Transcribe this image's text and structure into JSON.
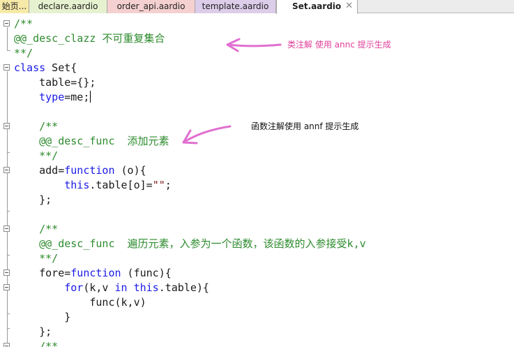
{
  "tabs": [
    {
      "label": "始页..."
    },
    {
      "label": "declare.aardio"
    },
    {
      "label": "order_api.aardio"
    },
    {
      "label": "template.aardio"
    },
    {
      "label": "Set.aardio",
      "active": true,
      "close": "✕"
    }
  ],
  "code": {
    "lines": [
      "/**",
      "@@_desc_clazz 不可重复集合",
      "**/",
      "class Set{",
      "    table={};",
      "    type=me;",
      "",
      "    /**",
      "    @@_desc_func  添加元素",
      "    **/",
      "    add=function (o){",
      "        this.table[o]=\"\";",
      "    };",
      "",
      "    /**",
      "    @@_desc_func  遍历元素，入参为一个函数，该函数的入参接受k,v",
      "    **/",
      "    fore=function (func){",
      "        for(k,v in this.table){",
      "            func(k,v)",
      "        }",
      "    };",
      "    /**"
    ]
  },
  "annotations": {
    "class_note": "类注解 使用 annc 提示生成",
    "func_note": "函数注解使用 annf 提示生成"
  },
  "colors": {
    "comment": "#2e8b2e",
    "keyword": "#1a1ae6",
    "string": "#7a1a1a",
    "class_note": "#e0409a",
    "func_note": "#111111",
    "arrow": "#e070d0"
  }
}
